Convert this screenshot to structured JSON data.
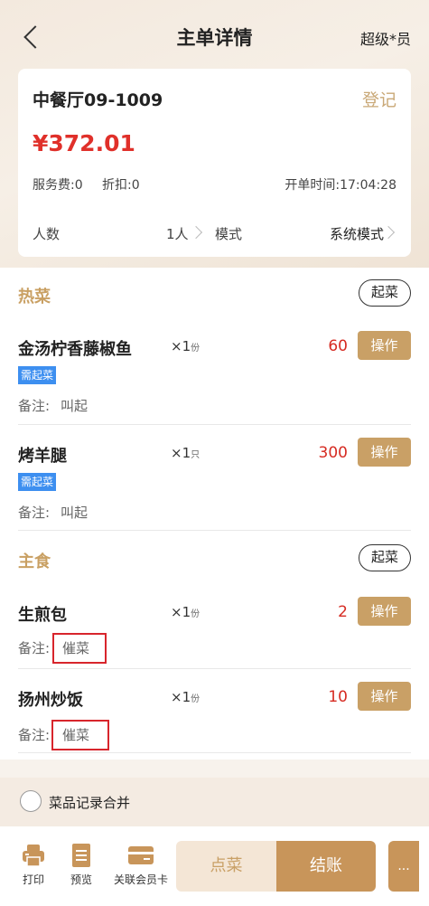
{
  "header": {
    "title": "主单详情",
    "user": "超级*员"
  },
  "order": {
    "table_name": "中餐厅09-1009",
    "register": "登记",
    "amount": "¥372.01",
    "service_fee": "服务费:0",
    "discount": "折扣:0",
    "open_time": "开单时间:17:04:28",
    "people_label": "人数",
    "people_value": "1人",
    "mode_label": "模式",
    "mode_value": "系统模式"
  },
  "categories": [
    {
      "title": "热菜",
      "serve_label": "起菜",
      "dishes": [
        {
          "name": "金汤柠香藤椒鱼",
          "qty": "×1",
          "unit": "份",
          "price": "60",
          "op": "操作",
          "tag": "需起菜",
          "note_label": "备注:",
          "note": "叫起"
        },
        {
          "name": "烤羊腿",
          "qty": "×1",
          "unit": "只",
          "price": "300",
          "op": "操作",
          "tag": "需起菜",
          "note_label": "备注:",
          "note": "叫起"
        }
      ]
    },
    {
      "title": "主食",
      "serve_label": "起菜",
      "dishes": [
        {
          "name": "生煎包",
          "qty": "×1",
          "unit": "份",
          "price": "2",
          "op": "操作",
          "note_label": "备注:",
          "note": "催菜"
        },
        {
          "name": "扬州炒饭",
          "qty": "×1",
          "unit": "份",
          "price": "10",
          "op": "操作",
          "note_label": "备注:",
          "note": "催菜"
        }
      ]
    }
  ],
  "merge": {
    "label": "菜品记录合并"
  },
  "footer": {
    "print": "打印",
    "preview": "预览",
    "member": "关联会员卡",
    "order_btn": "点菜",
    "pay_btn": "结账",
    "more_btn": "..."
  },
  "colors": {
    "accent": "#c9a066",
    "price": "#d62b22",
    "tag": "#3d8ff0"
  }
}
